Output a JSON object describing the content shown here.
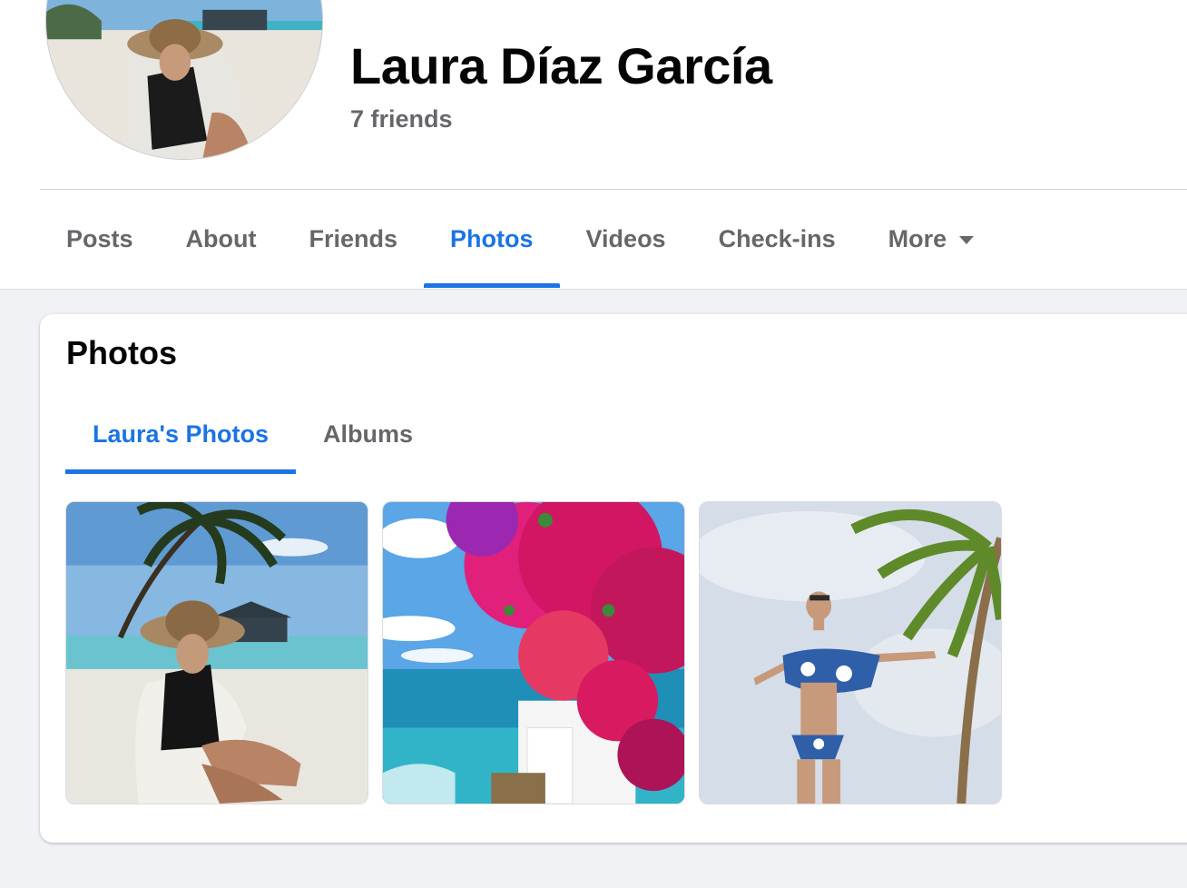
{
  "profile": {
    "name": "Laura Díaz García",
    "friends": "7 friends"
  },
  "nav": {
    "tabs": [
      {
        "label": "Posts"
      },
      {
        "label": "About"
      },
      {
        "label": "Friends"
      },
      {
        "label": "Photos"
      },
      {
        "label": "Videos"
      },
      {
        "label": "Check-ins"
      },
      {
        "label": "More"
      }
    ],
    "active_tab": "Photos"
  },
  "photos_section": {
    "title": "Photos",
    "tabs": [
      {
        "label": "Laura's Photos"
      },
      {
        "label": "Albums"
      }
    ],
    "active_tab": "Laura's Photos",
    "photos": [
      {
        "subject": "woman-in-hat-on-beach"
      },
      {
        "subject": "bougainvillea-over-sea"
      },
      {
        "subject": "woman-in-bikini-palm-tree"
      }
    ]
  },
  "colors": {
    "accent": "#1b74e4",
    "text_primary": "#050505",
    "text_secondary": "#65676b",
    "page_background": "#f0f2f5"
  }
}
